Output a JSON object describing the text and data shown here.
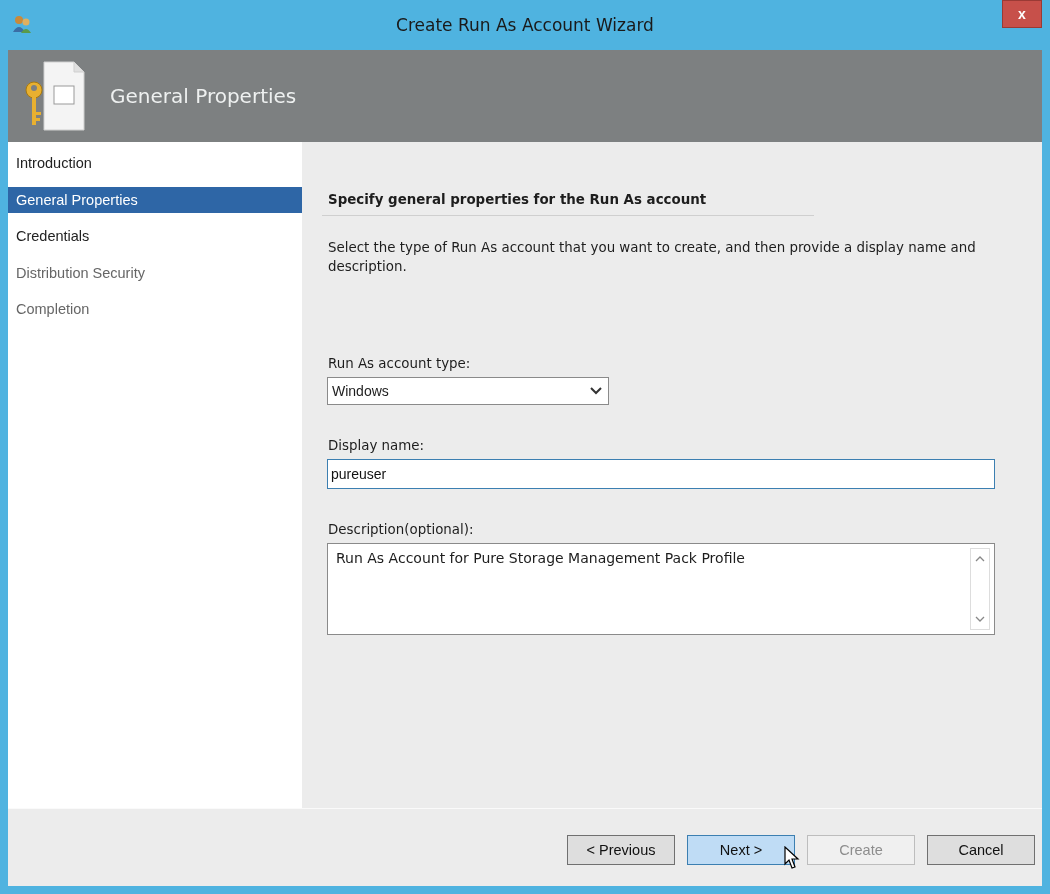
{
  "window": {
    "title": "Create Run As Account Wizard",
    "close": "x"
  },
  "header": {
    "title": "General Properties"
  },
  "sidebar": {
    "items": [
      {
        "label": "Introduction",
        "selected": false,
        "disabled": false
      },
      {
        "label": "General Properties",
        "selected": true,
        "disabled": false
      },
      {
        "label": "Credentials",
        "selected": false,
        "disabled": false
      },
      {
        "label": "Distribution Security",
        "selected": false,
        "disabled": true
      },
      {
        "label": "Completion",
        "selected": false,
        "disabled": true
      }
    ]
  },
  "page": {
    "heading": "Specify general properties for the Run As account",
    "intro": "Select the type of Run As account that you want to create, and then provide a display name and description.",
    "account_type": {
      "label": "Run As account type:",
      "value": "Windows"
    },
    "display_name": {
      "label": "Display name:",
      "value": "pureuser",
      "focused": true
    },
    "description": {
      "label": "Description(optional):",
      "value": "Run As Account for Pure Storage Management Pack Profile"
    }
  },
  "buttons": [
    {
      "label": "< Previous",
      "disabled": false,
      "hovered": false
    },
    {
      "label": "Next >",
      "disabled": false,
      "hovered": true
    },
    {
      "label": "Create",
      "disabled": true,
      "hovered": false
    },
    {
      "label": "Cancel",
      "disabled": false,
      "hovered": false
    }
  ]
}
